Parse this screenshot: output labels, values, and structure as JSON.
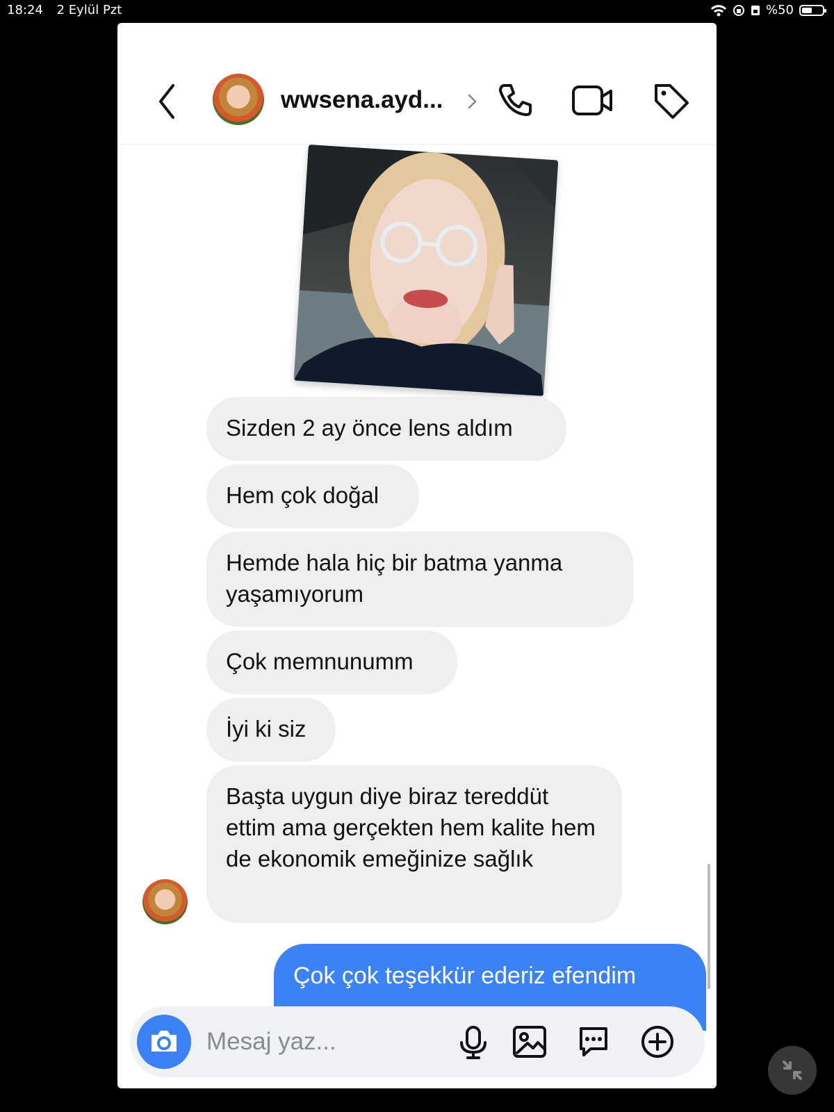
{
  "status": {
    "time": "18:24",
    "date": "2 Eylül Pzt",
    "battery_text": "%50",
    "battery_level": 0.5,
    "icons": [
      "wifi-icon",
      "location-lock-icon",
      "battery-icon"
    ]
  },
  "header": {
    "username": "wwsena.ayd...",
    "back_icon": "chevron-left-icon",
    "chevron_icon": "chevron-right-icon",
    "call_icon": "phone-icon",
    "video_icon": "video-icon",
    "tag_icon": "tag-icon"
  },
  "messages": [
    {
      "type": "received",
      "text": "Sizden 2 ay önce lens aldım"
    },
    {
      "type": "received",
      "text": "Hem çok doğal"
    },
    {
      "type": "received",
      "text": "Hemde hala hiç bir batma yanma yaşamıyorum"
    },
    {
      "type": "received",
      "text": "Çok memnunumm"
    },
    {
      "type": "received",
      "text": "İyi ki siz"
    },
    {
      "type": "received",
      "text": "Başta uygun diye biraz tereddüt ettim ama gerçekten hem kalite hem de ekonomik emeğinize sağlık"
    },
    {
      "type": "sent",
      "text": "Çok çok teşekkür ederiz efendim"
    }
  ],
  "composer": {
    "placeholder": "Mesaj yaz...",
    "camera_icon": "camera-icon",
    "mic_icon": "microphone-icon",
    "gallery_icon": "image-icon",
    "sticker_icon": "message-dots-icon",
    "plus_icon": "plus-circle-icon"
  },
  "colors": {
    "accent": "#3b82f6",
    "received_bubble": "#efeff2",
    "background": "#000000"
  }
}
